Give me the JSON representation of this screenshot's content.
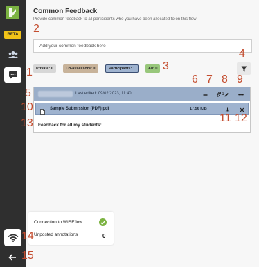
{
  "sidebar": {
    "beta_label": "BETA",
    "logo_icon": "wiseflow-check-logo",
    "items": [
      {
        "icon": "users-icon"
      },
      {
        "icon": "chat-bubble-icon",
        "active": true
      }
    ],
    "wifi_icon": "wifi-icon",
    "back_icon": "arrow-left-icon"
  },
  "main": {
    "title": "Common Feedback",
    "subtitle": "Provide common feedback to all participants who you have been allocated to on this flow",
    "input_placeholder": "Add your common feedback here",
    "filters": [
      {
        "label": "Private: 0",
        "color": "#d7d7d7"
      },
      {
        "label": "Co-assessors: 0",
        "color": "#c8b39a"
      },
      {
        "label": "Participants: 1",
        "color": "#9fb3cf"
      },
      {
        "label": "All: 0",
        "color": "#98c77b"
      }
    ],
    "filter_icon": "funnel-icon"
  },
  "card": {
    "last_edited": "Last edited: 09/02/2023, 11:40",
    "attachment_count": "1",
    "file_name": "Sample Submission (PDF).pdf",
    "file_size": "17.56 KiB",
    "feedback_text": "Feedback for all my students:",
    "header_bg": "#9aaec9"
  },
  "status": {
    "connection_label": "Connection to WISEflow",
    "unposted_label": "Unposted annotations",
    "unposted_count": "0",
    "ok_color": "#7cb342"
  },
  "annotations": [
    "1",
    "2",
    "3",
    "4",
    "5",
    "6",
    "7",
    "8",
    "9",
    "10",
    "11",
    "12",
    "13",
    "14",
    "15"
  ]
}
